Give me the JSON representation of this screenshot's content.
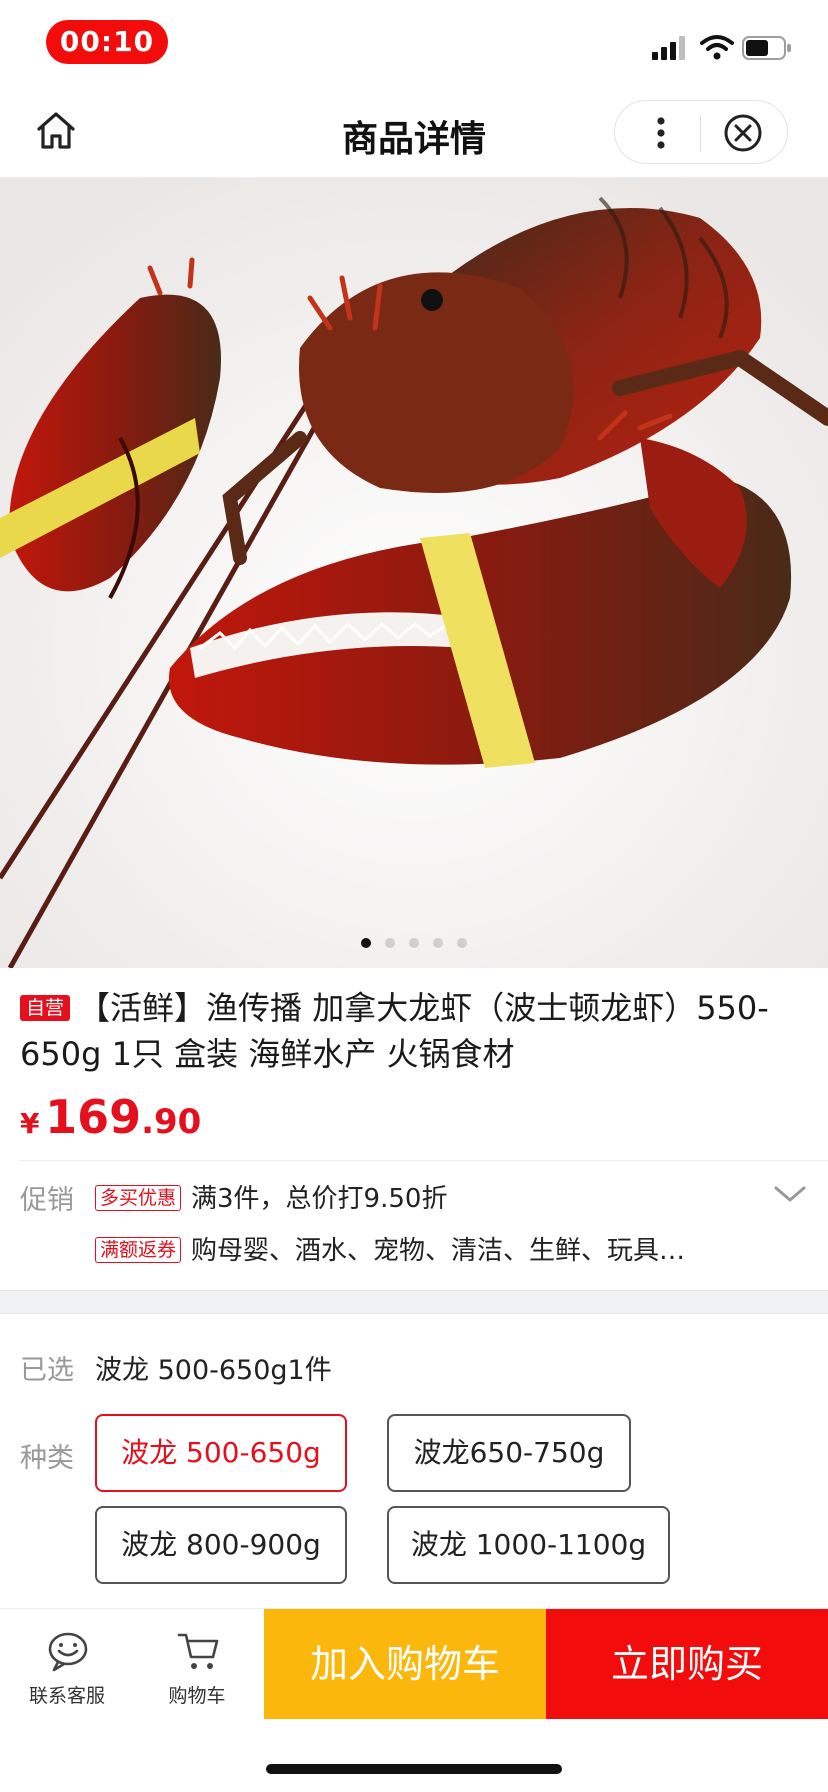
{
  "status_bar": {
    "time": "00:10",
    "icons": [
      "signal-icon",
      "wifi-icon",
      "battery-icon"
    ],
    "time_pill_color": "#f20c0c"
  },
  "nav": {
    "title": "商品详情",
    "icons": [
      "home-icon",
      "more-icon",
      "close-icon"
    ]
  },
  "gallery": {
    "image": "lobster-photo",
    "page_count": 5,
    "active_index": 0
  },
  "product": {
    "self_badge": "自营",
    "title": "【活鲜】渔传播 加拿大龙虾（波士顿龙虾）550-650g 1只 盒装 海鲜水产 火锅食材",
    "price_symbol": "¥",
    "price_int": "169",
    "price_dec": ".90"
  },
  "promotion": {
    "label": "促销",
    "items": [
      {
        "tag": "多买优惠",
        "text": "满3件，总价打9.50折"
      },
      {
        "tag": "满额返券",
        "text": "购母婴、酒水、宠物、清洁、生鲜、玩具…"
      }
    ]
  },
  "selection": {
    "selected_label": "已选",
    "selected_value": "波龙 500-650g1件",
    "type_label": "种类",
    "options": [
      {
        "label": "波龙 500-650g",
        "selected": true
      },
      {
        "label": "波龙650-750g",
        "selected": false
      },
      {
        "label": "波龙 800-900g",
        "selected": false
      },
      {
        "label": "波龙 1000-1100g",
        "selected": false
      }
    ]
  },
  "bottom_bar": {
    "service_label": "联系客服",
    "cart_label": "购物车",
    "add_to_cart": "加入购物车",
    "buy_now": "立即购买",
    "add_to_cart_color": "#fbb70c",
    "buy_now_color": "#f20c0c"
  },
  "colors": {
    "accent_red": "#e4101e"
  }
}
